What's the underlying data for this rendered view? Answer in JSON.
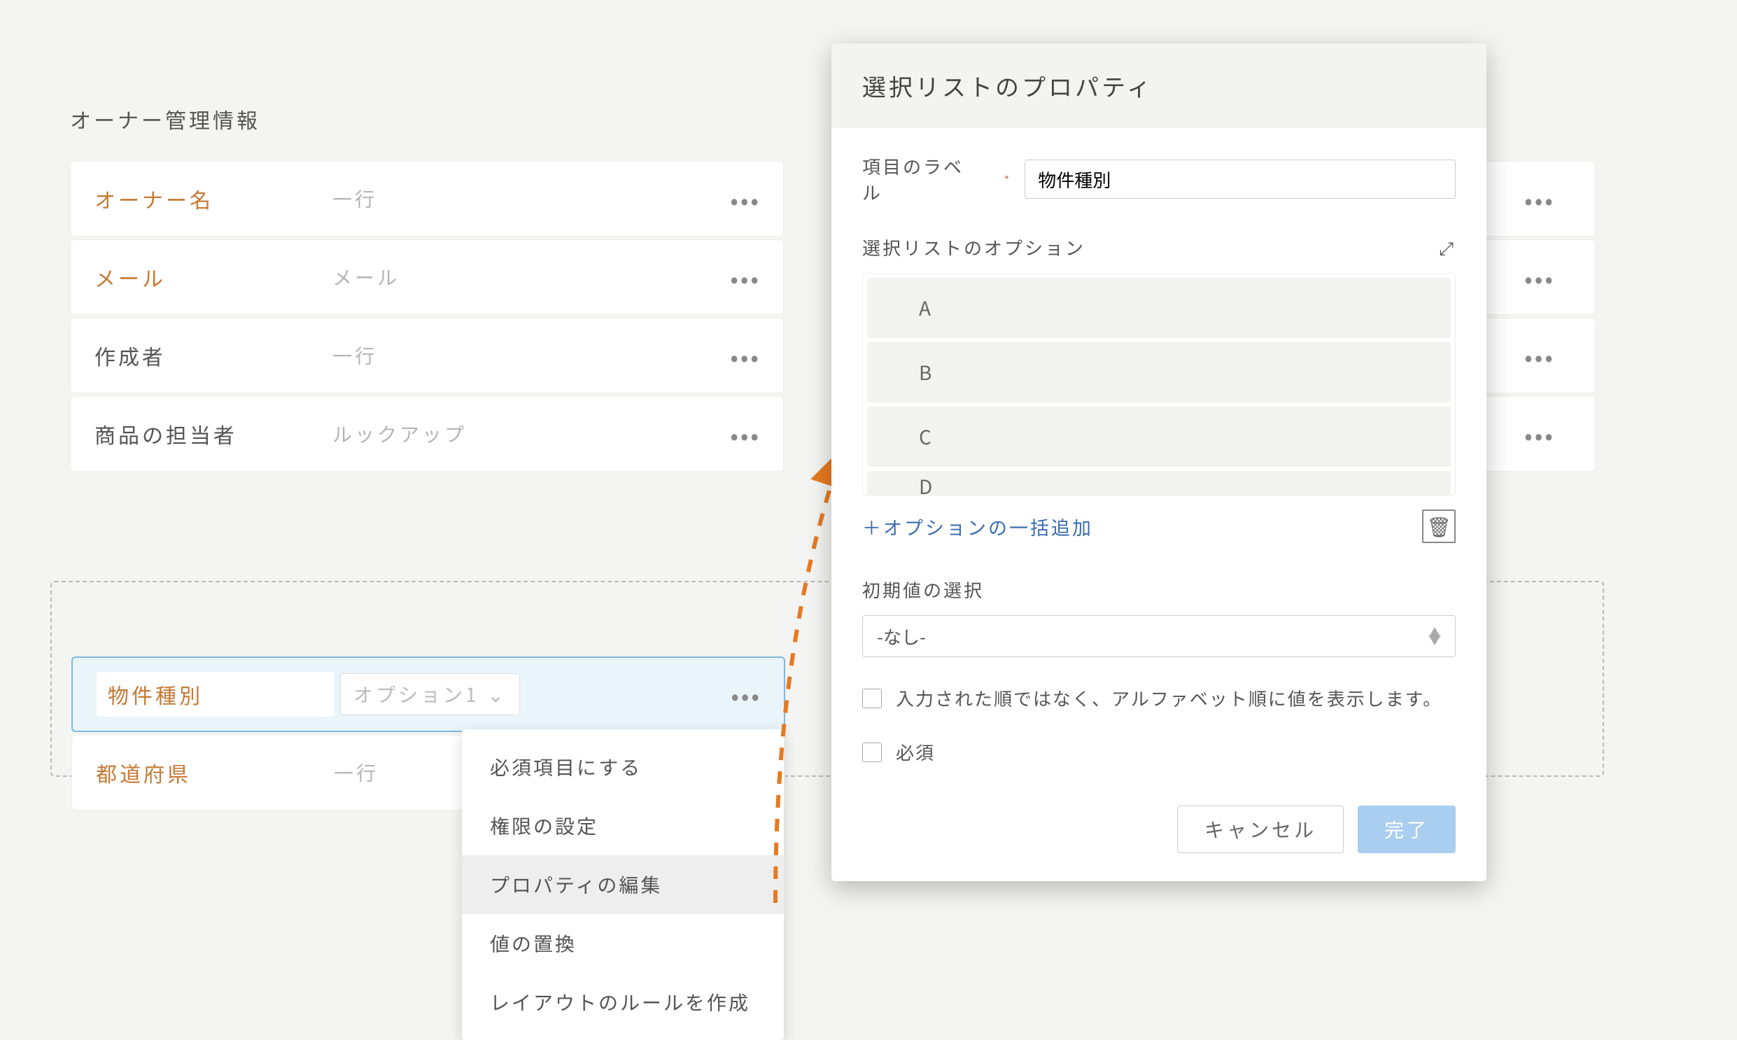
{
  "section_title": "オーナー管理情報",
  "fields": [
    {
      "name": "オーナー名",
      "type": "一行",
      "style": "orange"
    },
    {
      "name": "メール",
      "type": "メール",
      "style": "orange"
    },
    {
      "name": "作成者",
      "type": "一行",
      "style": "dark"
    },
    {
      "name": "商品の担当者",
      "type": "ルックアップ",
      "style": "dark"
    }
  ],
  "dots": "•••",
  "new_section": {
    "fields": [
      {
        "name": "物件種別",
        "preview": "オプション1",
        "selected": true
      },
      {
        "name": "都道府県",
        "type": "一行"
      }
    ]
  },
  "context_menu": {
    "items": [
      "必須項目にする",
      "権限の設定",
      "プロパティの編集",
      "値の置換",
      "レイアウトのルールを作成"
    ],
    "hover_index": 2
  },
  "modal": {
    "title": "選択リストのプロパティ",
    "label_field": "項目のラベル",
    "label_value": "物件種別",
    "options_label": "選択リストのオプション",
    "options": [
      "A",
      "B",
      "C",
      "D"
    ],
    "add_options": "＋オプションの一括追加",
    "default_label": "初期値の選択",
    "default_value": "-なし-",
    "alpha_sort": "入力された順ではなく、アルファベット順に値を表示します。",
    "required": "必須",
    "cancel": "キャンセル",
    "done": "完了"
  }
}
